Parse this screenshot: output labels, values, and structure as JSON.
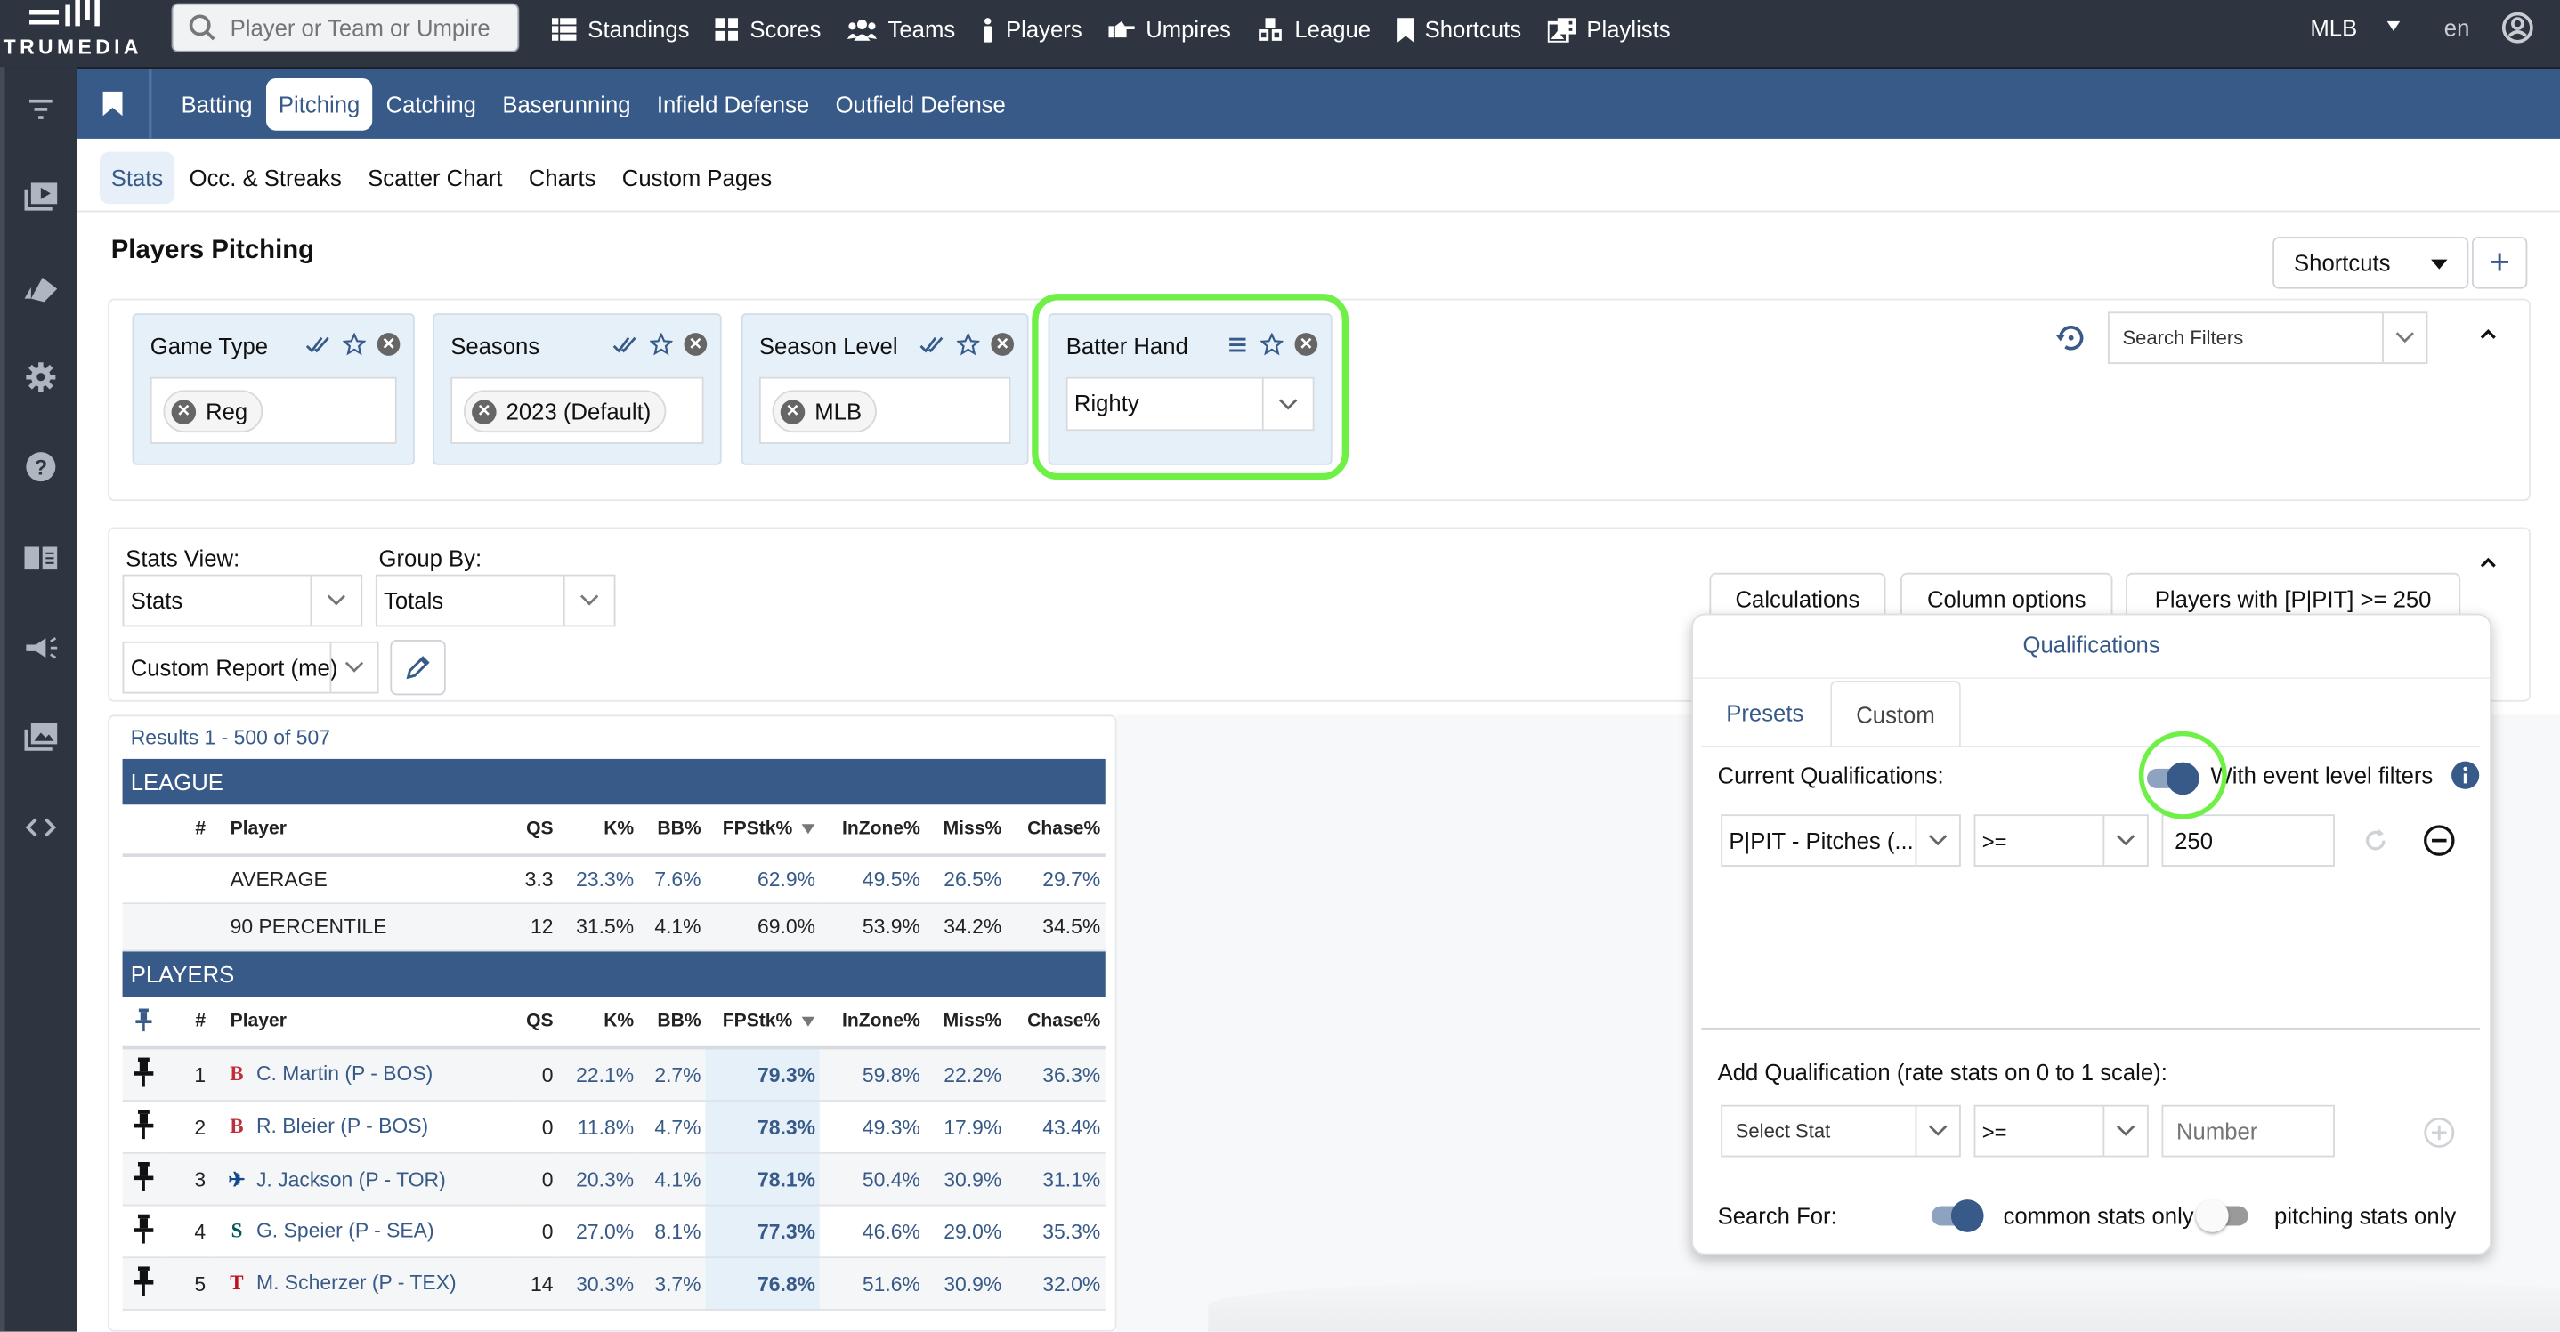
{
  "topbar": {
    "brand": "TRUMEDIA",
    "search_placeholder": "Player or Team or Umpire",
    "nav": [
      {
        "label": "Standings",
        "icon": "list-icon"
      },
      {
        "label": "Scores",
        "icon": "grid-icon"
      },
      {
        "label": "Teams",
        "icon": "users-icon"
      },
      {
        "label": "Players",
        "icon": "person-icon"
      },
      {
        "label": "Umpires",
        "icon": "hand-point-icon"
      },
      {
        "label": "League",
        "icon": "cubes-icon"
      },
      {
        "label": "Shortcuts",
        "icon": "bookmark-icon"
      },
      {
        "label": "Playlists",
        "icon": "photo-film-icon"
      }
    ],
    "league_select": "MLB",
    "language": "en"
  },
  "sidebar": {
    "icons": [
      "filter-icon",
      "video-playlist-icon",
      "tent-icon",
      "gear-icon",
      "help-icon",
      "book-icon",
      "megaphone-icon",
      "images-icon",
      "code-icon"
    ]
  },
  "main_tabs": {
    "items": [
      "Batting",
      "Pitching",
      "Catching",
      "Baserunning",
      "Infield Defense",
      "Outfield Defense"
    ],
    "active": "Pitching"
  },
  "sub_tabs": {
    "items": [
      "Stats",
      "Occ. & Streaks",
      "Scatter Chart",
      "Charts",
      "Custom Pages"
    ],
    "active": "Stats"
  },
  "page": {
    "title": "Players Pitching",
    "shortcuts_label": "Shortcuts",
    "add_label": "+"
  },
  "filters": {
    "cards": [
      {
        "label": "Game Type",
        "chips": [
          "Reg"
        ]
      },
      {
        "label": "Seasons",
        "chips": [
          "2023 (Default)"
        ]
      },
      {
        "label": "Season Level",
        "chips": [
          "MLB"
        ]
      },
      {
        "label": "Batter Hand",
        "value": "Righty"
      }
    ],
    "search_placeholder": "Search Filters"
  },
  "stats_view": {
    "stats_view_label": "Stats View:",
    "stats_view_value": "Stats",
    "group_by_label": "Group By:",
    "group_by_value": "Totals",
    "report_value": "Custom Report (me)",
    "calculations_label": "Calculations",
    "column_options_label": "Column options",
    "qualification_label": "Players with [P|PIT] >= 250"
  },
  "table": {
    "results": "Results 1 - 500 of 507",
    "league_header": "LEAGUE",
    "players_header": "PLAYERS",
    "columns": [
      "#",
      "Player",
      "QS",
      "K%",
      "BB%",
      "FPStk%",
      "InZone%",
      "Miss%",
      "Chase%"
    ],
    "sorted_column": "FPStk%",
    "league_rows": [
      {
        "player": "AVERAGE",
        "qs": "3.3",
        "k": "23.3%",
        "bb": "7.6%",
        "fpstk": "62.9%",
        "inzone": "49.5%",
        "miss": "26.5%",
        "chase": "29.7%"
      },
      {
        "player": "90 PERCENTILE",
        "qs": "12",
        "k": "31.5%",
        "bb": "4.1%",
        "fpstk": "69.0%",
        "inzone": "53.9%",
        "miss": "34.2%",
        "chase": "34.5%"
      }
    ],
    "player_rows": [
      {
        "rank": "1",
        "team": "BOS",
        "team_glyph": "B",
        "team_color": "#bd3039",
        "player": "C. Martin (P - BOS)",
        "qs": "0",
        "k": "22.1%",
        "bb": "2.7%",
        "fpstk": "79.3%",
        "inzone": "59.8%",
        "miss": "22.2%",
        "chase": "36.3%"
      },
      {
        "rank": "2",
        "team": "BOS",
        "team_glyph": "B",
        "team_color": "#bd3039",
        "player": "R. Bleier (P - BOS)",
        "qs": "0",
        "k": "11.8%",
        "bb": "4.7%",
        "fpstk": "78.3%",
        "inzone": "49.3%",
        "miss": "17.9%",
        "chase": "43.4%"
      },
      {
        "rank": "3",
        "team": "TOR",
        "team_glyph": "✈",
        "team_color": "#134a8e",
        "player": "J. Jackson (P - TOR)",
        "qs": "0",
        "k": "20.3%",
        "bb": "4.1%",
        "fpstk": "78.1%",
        "inzone": "50.4%",
        "miss": "30.9%",
        "chase": "31.1%"
      },
      {
        "rank": "4",
        "team": "SEA",
        "team_glyph": "S",
        "team_color": "#005c5c",
        "player": "G. Speier (P - SEA)",
        "qs": "0",
        "k": "27.0%",
        "bb": "8.1%",
        "fpstk": "77.3%",
        "inzone": "46.6%",
        "miss": "29.0%",
        "chase": "35.3%"
      },
      {
        "rank": "5",
        "team": "TEX",
        "team_glyph": "T",
        "team_color": "#c0111f",
        "player": "M. Scherzer (P - TEX)",
        "qs": "14",
        "k": "30.3%",
        "bb": "3.7%",
        "fpstk": "76.8%",
        "inzone": "51.6%",
        "miss": "30.9%",
        "chase": "32.0%"
      }
    ]
  },
  "qualifications": {
    "title": "Qualifications",
    "tabs": [
      "Presets",
      "Custom"
    ],
    "active_tab": "Custom",
    "current_label": "Current Qualifications:",
    "event_filters_label": "With event level filters",
    "event_filters_on": true,
    "current": {
      "stat": "P|PIT - Pitches (...",
      "operator": ">=",
      "value": "250"
    },
    "add_label": "Add Qualification (rate stats on 0 to 1 scale):",
    "add_stat_placeholder": "Select Stat",
    "add_operator": ">=",
    "add_number_placeholder": "Number",
    "search_for_label": "Search For:",
    "common_stats_label": "common stats only",
    "common_stats_on": true,
    "pitching_stats_label": "pitching stats only",
    "pitching_stats_on": false
  },
  "colors": {
    "topbar": "#2e3541",
    "brand_blue": "#375a88",
    "highlight_green": "#6ff047",
    "filter_card_bg": "#e6f0f9"
  }
}
